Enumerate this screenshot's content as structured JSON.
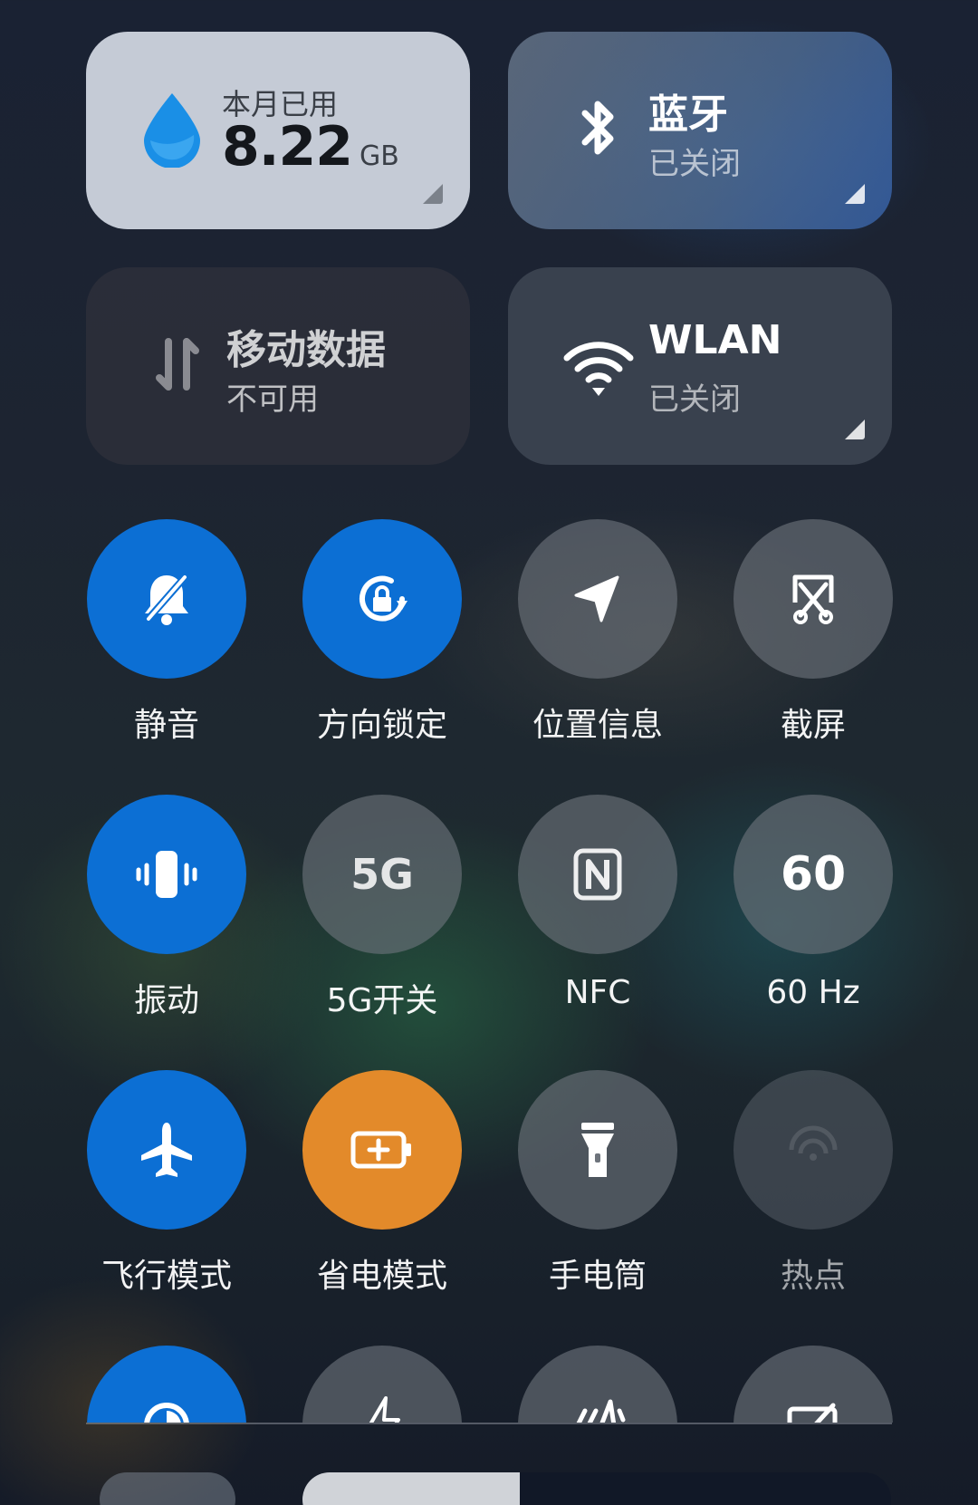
{
  "cards": {
    "data_usage": {
      "label": "本月已用",
      "value": "8.22",
      "unit": "GB",
      "icon": "water-drop-icon"
    },
    "bluetooth": {
      "title": "蓝牙",
      "status": "已关闭",
      "icon": "bluetooth-icon"
    },
    "mobile_data": {
      "title": "移动数据",
      "status": "不可用",
      "icon": "data-arrows-icon"
    },
    "wlan": {
      "title": "WLAN",
      "status": "已关闭",
      "icon": "wifi-icon"
    }
  },
  "toggles": [
    {
      "label": "静音",
      "icon": "bell-off-icon",
      "state": "on"
    },
    {
      "label": "方向锁定",
      "icon": "rotation-lock-icon",
      "state": "on"
    },
    {
      "label": "位置信息",
      "icon": "location-arrow-icon",
      "state": "off"
    },
    {
      "label": "截屏",
      "icon": "screenshot-icon",
      "state": "off"
    },
    {
      "label": "振动",
      "icon": "vibrate-icon",
      "state": "on"
    },
    {
      "label": "5G开关",
      "icon": "5g-icon",
      "icon_text": "5G",
      "state": "off"
    },
    {
      "label": "NFC",
      "icon": "nfc-icon",
      "state": "off"
    },
    {
      "label": "60 Hz",
      "icon": "refresh-rate-icon",
      "icon_text": "60",
      "state": "off"
    },
    {
      "label": "飞行模式",
      "icon": "airplane-icon",
      "state": "on"
    },
    {
      "label": "省电模式",
      "icon": "battery-saver-icon",
      "state": "on"
    },
    {
      "label": "手电筒",
      "icon": "flashlight-icon",
      "state": "off"
    },
    {
      "label": "热点",
      "icon": "hotspot-icon",
      "state": "disabled"
    }
  ],
  "colors": {
    "active_blue": "#0c6fd4",
    "active_orange": "#e38a2a",
    "inactive_gray": "#6e747c"
  }
}
